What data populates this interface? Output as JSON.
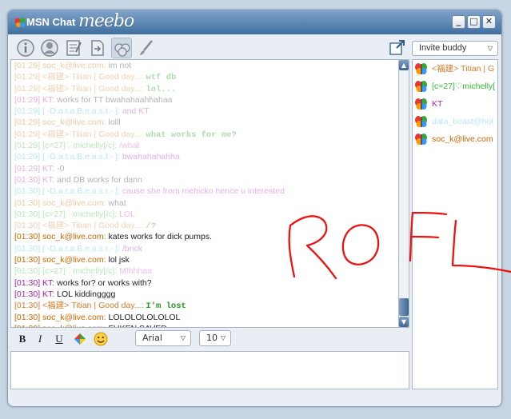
{
  "window": {
    "title": "MSN Chat",
    "brand": "meebo",
    "controls": {
      "minimize": "_",
      "maximize": "□",
      "close": "✕"
    }
  },
  "toolbar": {
    "tools": [
      {
        "name": "info-icon"
      },
      {
        "name": "profile-icon"
      },
      {
        "name": "notes-icon"
      },
      {
        "name": "send-file-icon"
      },
      {
        "name": "group-chat-icon"
      },
      {
        "name": "brush-icon"
      }
    ],
    "popout_icon": "popout-icon"
  },
  "colors": {
    "titlebar": "#4a7aa8",
    "timestamp_orange": "#cc6600",
    "titian": "#d87a2a",
    "michelly": "#33bb33",
    "kt": "#aa22aa",
    "soc_k": "#cc6600",
    "databeast": "#33bbdd",
    "doodle": "#ee1111"
  },
  "messages": [
    {
      "time": "[01:29]",
      "user": "soc_k@live.com:",
      "text": "im not",
      "color": "#cc6600",
      "faded": true,
      "bold": false
    },
    {
      "time": "[01:29]",
      "user": "<福建> Titian | Good day...:",
      "text": "wtf db",
      "color": "#d87a2a",
      "faded": true,
      "bold": true,
      "textColor": "#229922"
    },
    {
      "time": "[01:29]",
      "user": "<福建> Titian | Good day...:",
      "text": "lol...",
      "color": "#d87a2a",
      "faded": true,
      "bold": true,
      "textColor": "#229922"
    },
    {
      "time": "[01:29]",
      "user": "KT:",
      "text": "works for TT bwahahaahhahaa",
      "color": "#aa22aa",
      "faded": true,
      "bold": false
    },
    {
      "time": "[01:29]",
      "user": "[ -D.a.t.a.B.e.a.s.t.- ]:",
      "text": "and KT",
      "color": "#33bbdd",
      "faded": true,
      "bold": false,
      "textColor": "#aa22aa"
    },
    {
      "time": "[01:29]",
      "user": "soc_k@live.com:",
      "text": "lolll",
      "color": "#cc6600",
      "faded": true,
      "bold": false
    },
    {
      "time": "[01:29]",
      "user": "<福建> Titian | Good day...:",
      "text": "what works for me?",
      "color": "#d87a2a",
      "faded": true,
      "bold": true,
      "textColor": "#229922"
    },
    {
      "time": "[01:29]",
      "user": "[c=27]♡michelly[/c]:",
      "text": "/what",
      "color": "#33bb33",
      "faded": true,
      "bold": false,
      "textColor": "#cc44cc"
    },
    {
      "time": "[01:29]",
      "user": "[ -D.a.t.a.B.e.a.s.t.- ]:",
      "text": "bwahahahahha",
      "color": "#33bbdd",
      "faded": true,
      "bold": false,
      "textColor": "#aa22aa"
    },
    {
      "time": "[01:29]",
      "user": "KT:",
      "text": "-0",
      "color": "#aa22aa",
      "faded": true,
      "bold": false
    },
    {
      "time": "[01:30]",
      "user": "KT:",
      "text": "and DB works for dann",
      "color": "#aa22aa",
      "faded": true,
      "bold": false
    },
    {
      "time": "[01:30]",
      "user": "[ -D.a.t.a.B.e.a.s.t.- ]:",
      "text": "cause she from mehicko hence u interested",
      "color": "#33bbdd",
      "faded": true,
      "bold": false,
      "textColor": "#aa22aa"
    },
    {
      "time": "[01:30]",
      "user": "soc_k@live.com:",
      "text": "what",
      "color": "#cc6600",
      "faded": true,
      "bold": false
    },
    {
      "time": "[01:30]",
      "user": "[c=27]♡michelly[/c]:",
      "text": "LOL",
      "color": "#33bb33",
      "faded": true,
      "bold": false,
      "textColor": "#cc44cc"
    },
    {
      "time": "[01:30]",
      "user": "<福建> Titian | Good day...:",
      "text": "/?",
      "color": "#d87a2a",
      "faded": true,
      "bold": true,
      "textColor": "#229922"
    },
    {
      "time": "[01:30]",
      "user": "soc_k@live.com:",
      "text": "kates works for dick pumps.",
      "color": "#cc6600",
      "faded": false,
      "bold": false
    },
    {
      "time": "[01:30]",
      "user": "[ -D.a.t.a.B.e.a.s.t.- ]:",
      "text": "/brick",
      "color": "#33bbdd",
      "faded": true,
      "bold": false,
      "textColor": "#aa22aa"
    },
    {
      "time": "[01:30]",
      "user": "soc_k@live.com:",
      "text": "lol jsk",
      "color": "#cc6600",
      "faded": false,
      "bold": false
    },
    {
      "time": "[01:30]",
      "user": "[c=27]♡michelly[/c]:",
      "text": "M!hhhaa",
      "color": "#33bb33",
      "faded": true,
      "bold": false,
      "textColor": "#cc44cc"
    },
    {
      "time": "[01:30]",
      "user": "KT:",
      "text": "works for? or works with?",
      "color": "#aa22aa",
      "faded": false,
      "bold": false
    },
    {
      "time": "[01:30]",
      "user": "KT:",
      "text": "LOL kiddingggg",
      "color": "#aa22aa",
      "faded": false,
      "bold": false
    },
    {
      "time": "[01:30]",
      "user": "<福建> Titian | Good day...:",
      "text": "I'm lost",
      "color": "#d87a2a",
      "faded": false,
      "bold": true,
      "textColor": "#229922"
    },
    {
      "time": "[01:30]",
      "user": "soc_k@live.com:",
      "text": "LOLOLOLOLOLOL",
      "color": "#cc6600",
      "faded": false,
      "bold": false
    },
    {
      "time": "[01:30]",
      "user": "soc_k@live.com:",
      "text": "FUKEN SAVED",
      "color": "#cc6600",
      "faded": false,
      "bold": false
    }
  ],
  "format": {
    "bold": "B",
    "italic": "I",
    "underline": "U",
    "font": "Arial",
    "size": "10",
    "color_icon": "color-picker-icon",
    "emoticon_icon": "smiley-icon"
  },
  "invite": {
    "label": "Invite buddy"
  },
  "buddies": [
    {
      "name": "<福建> Titian | G",
      "color": "#d87a2a",
      "faded": false
    },
    {
      "name": "[c=27]♡michelly[",
      "color": "#33bb33",
      "faded": false
    },
    {
      "name": "KT",
      "color": "#aa22aa",
      "faded": false
    },
    {
      "name": "data_beast@hot",
      "color": "#33bbdd",
      "faded": true
    },
    {
      "name": "soc_k@live.com",
      "color": "#cc6600",
      "faded": false
    }
  ],
  "doodle": {
    "text": "ROFL"
  }
}
